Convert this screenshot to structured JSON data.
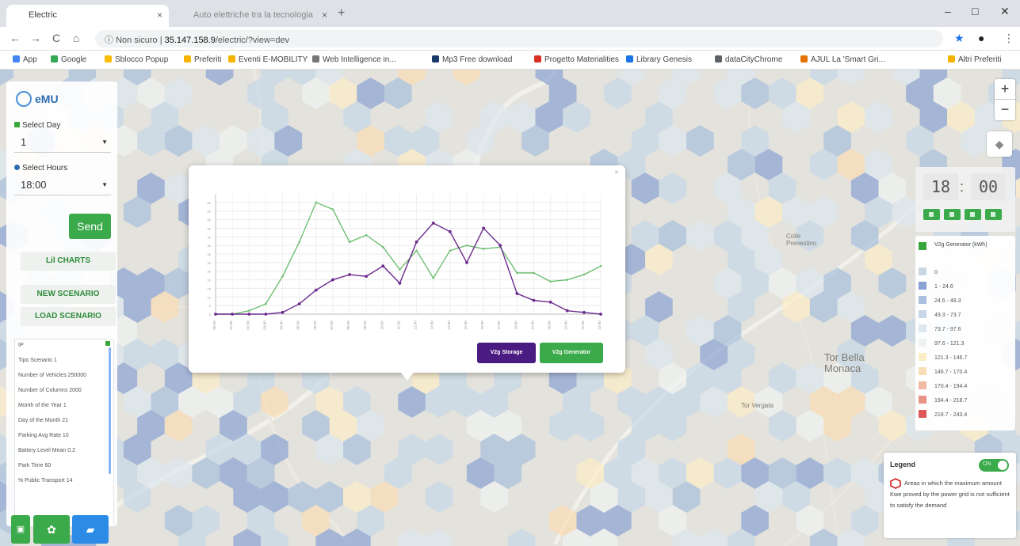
{
  "browser": {
    "tabs": [
      {
        "title": "Electric"
      },
      {
        "title": "Auto elettriche tra la tecnologia"
      }
    ],
    "new_tab": "+",
    "controls": [
      "–",
      "□",
      "✕"
    ],
    "nav": {
      "back": "←",
      "forward": "→",
      "reload": "C",
      "home": "⌂"
    },
    "address": {
      "security": "Non sicuro",
      "url": "35.147.158.9",
      "path": "/electric/?view=dev"
    },
    "bookmarks": [
      "App",
      "Google",
      "Sblocco Popup",
      "Preferiti",
      "Eventi E-MOBILITY",
      "Web Intelligence in...",
      "Mp3 Free download",
      "Progetto Materialities",
      "Library Genesis",
      "dataCityChrome",
      "AJUL La 'Smart Gri...",
      "Altri Preferiti"
    ],
    "bookmark_colors": [
      "#4285f4",
      "#34a853",
      "#fbbc05",
      "#f4b400",
      "#f4b400",
      "#777777",
      "#1a3a6b",
      "#d93025",
      "#1a73e8",
      "#5f6368",
      "#e37400",
      "#f4b400"
    ]
  },
  "app": {
    "brand": "eMU",
    "select_day_label": "Select Day",
    "day_value": "1",
    "select_hours_label": "Select Hours",
    "hours_value": "18:00",
    "send": "Send",
    "charts": "Lil CHARTS",
    "new_scenario": "NEW SCENARIO",
    "load_scenario": "LOAD SCENARIO",
    "params": [
      "IP",
      "Tipo Scenario 1",
      "Number of Vehicles 250000",
      "Number of Columns 2000",
      "Month of the Year 1",
      "Day of the Month 21",
      "Parking Avg Rate 10",
      "Battery Level Mean 0.2",
      "Park Time 60",
      "% Public Transport 14"
    ],
    "map_labels": [
      "Tor Bella Monaca",
      "Colle Prenestino",
      "Tor Vergata"
    ],
    "zoom": {
      "in": "+",
      "out": "−"
    },
    "time": {
      "hh": "18",
      "mm": "00",
      "sep": ":"
    },
    "legend_title": "V2g Generator (kWh)",
    "legend_bins": [
      {
        "label": "0",
        "color": "#c9d7e5"
      },
      {
        "label": "1 - 24.6",
        "color": "#8aa3d4"
      },
      {
        "label": "24.6 - 49.3",
        "color": "#a9c0de"
      },
      {
        "label": "49.3 - 73.7",
        "color": "#c6d8e8"
      },
      {
        "label": "73.7 - 97.6",
        "color": "#dce8f0"
      },
      {
        "label": "97.6 - 121.3",
        "color": "#eef3f2"
      },
      {
        "label": "121.3 - 146.7",
        "color": "#fbedc8"
      },
      {
        "label": "146.7 - 170.4",
        "color": "#f9dcb5"
      },
      {
        "label": "170.4 - 194.4",
        "color": "#efb9a3"
      },
      {
        "label": "194.4 - 218.7",
        "color": "#e99283"
      },
      {
        "label": "218.7 - 243.4",
        "color": "#e05757"
      }
    ],
    "legend2": {
      "title": "Legend",
      "toggle": "ON",
      "text": "Areas in which the maximum amount Kwe proved by the power grid is not sufficient to satisfy the demand"
    },
    "popup_buttons": {
      "storage": "V2g Storage",
      "generator": "V2g Generator"
    }
  },
  "chart_data": {
    "type": "line",
    "x": [
      "00:00",
      "01:00",
      "02:00",
      "03:00",
      "04:00",
      "05:00",
      "06:00",
      "07:00",
      "08:00",
      "09:00",
      "10:00",
      "11:00",
      "12:00",
      "13:00",
      "14:00",
      "15:00",
      "16:00",
      "17:00",
      "18:00",
      "19:00",
      "20:00",
      "21:00",
      "22:00",
      "23:00"
    ],
    "series": [
      {
        "name": "V2g Generator",
        "color": "#6fbf72",
        "values": [
          0,
          0,
          2,
          6,
          22,
          42,
          65,
          61,
          42,
          46,
          39,
          26,
          37,
          21,
          37,
          40,
          38,
          39,
          24,
          24,
          19,
          20,
          23,
          28
        ]
      },
      {
        "name": "V2g Storage",
        "color": "#6c2c8f",
        "values": [
          0,
          0,
          0,
          0,
          1,
          6,
          14,
          20,
          23,
          22,
          28,
          18,
          42,
          53,
          48,
          30,
          50,
          40,
          12,
          8,
          7,
          2,
          1,
          0
        ]
      }
    ],
    "ylim": [
      0,
      70
    ],
    "yticks": [
      0,
      5,
      10,
      15,
      20,
      25,
      30,
      35,
      40,
      45,
      50,
      55,
      60,
      65
    ],
    "grid": true
  }
}
